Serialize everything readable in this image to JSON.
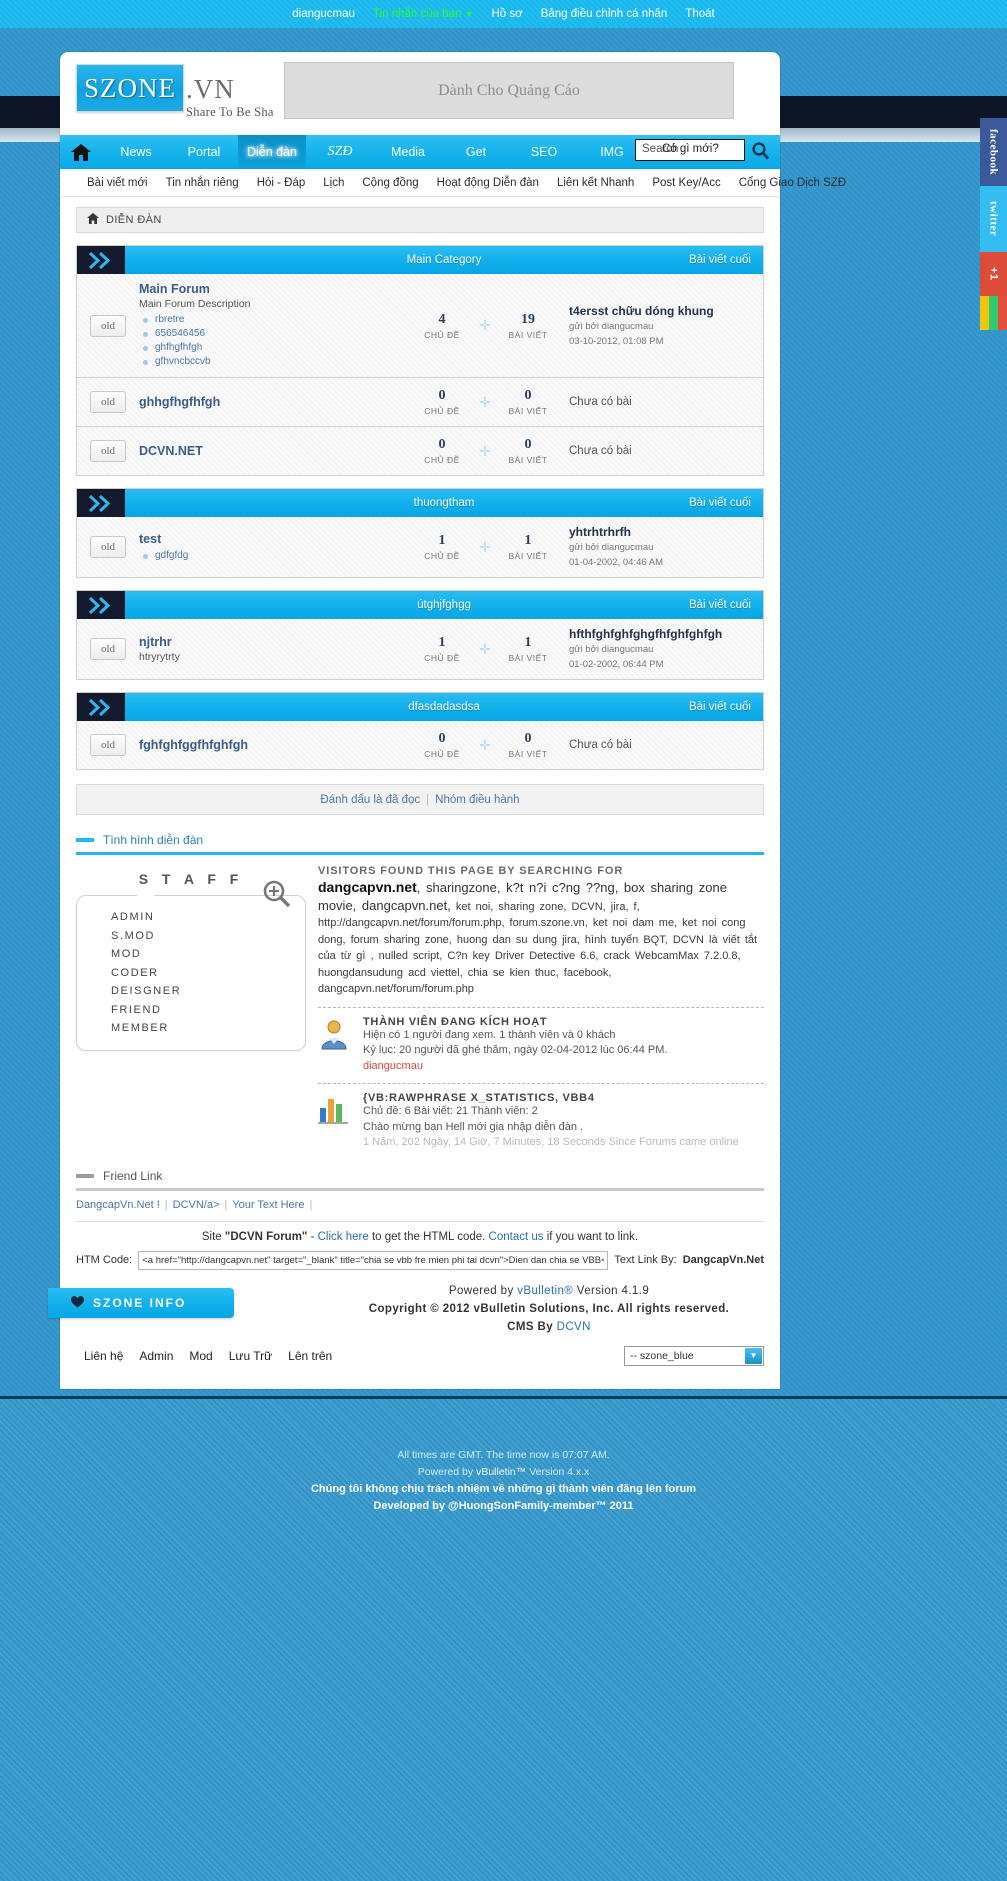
{
  "topbar": {
    "user": "diangucmau",
    "pm": "Tin nhắn của bạn",
    "caret": "▼",
    "profile": "Hồ sơ",
    "cp": "Bảng điều chỉnh cá nhân",
    "logout": "Thoát"
  },
  "header": {
    "logo_text": "SZONE",
    "logo_vn": ".VN",
    "logo_tagline": "Share To Be Sha",
    "ad_text": "Dành Cho Quảng Cáo"
  },
  "nav": {
    "home_icon": "home-icon",
    "items": [
      {
        "label": "News",
        "active": false,
        "italic": false
      },
      {
        "label": "Portal",
        "active": false,
        "italic": false
      },
      {
        "label": "Diễn đàn",
        "active": true,
        "italic": false
      },
      {
        "label": "SZĐ",
        "active": false,
        "italic": true
      },
      {
        "label": "Media",
        "active": false,
        "italic": false
      },
      {
        "label": "Get",
        "active": false,
        "italic": false
      },
      {
        "label": "SEO",
        "active": false,
        "italic": false
      },
      {
        "label": "IMG",
        "active": false,
        "italic": false
      }
    ],
    "search_placeholder": "Search",
    "search_overlay": "Có gì mới?",
    "search_icon": "magnifier-icon"
  },
  "nav2": {
    "items": [
      "Bài viết mới",
      "Tin nhắn riêng",
      "Hỏi - Đáp",
      "Lịch",
      "Cộng đồng",
      "Hoạt động Diễn đàn",
      "Liên kết Nhanh",
      "Post Key/Acc",
      "Cổng Giao Dịch SZĐ"
    ]
  },
  "breadcrumb": {
    "home_icon": "home-icon",
    "label": "DIỄN ĐÀN"
  },
  "forum": {
    "last_post_col": "Bài viết cuối",
    "threads_label": "CHỦ ĐỀ",
    "posts_label": "BÀI VIẾT",
    "no_post": "Chưa có bài",
    "old_badge": "old",
    "categories": [
      {
        "title": "Main Category",
        "rows": [
          {
            "name": "Main Forum",
            "desc": "Main Forum Description",
            "subs": [
              "rbretre",
              "656546456",
              "ghfhgfhfgh",
              "gfhvncbccvb"
            ],
            "threads": "4",
            "posts": "19",
            "last_title": "t4ersst chữu dóng khung",
            "last_by": "gửi bởi diangucmau",
            "last_date": "03-10-2012, 01:08 PM"
          },
          {
            "name": "ghhgfhgfhfgh",
            "desc": "",
            "subs": [],
            "threads": "0",
            "posts": "0",
            "last_title": "Chưa có bài",
            "last_by": "",
            "last_date": ""
          },
          {
            "name": "DCVN.NET",
            "desc": "",
            "subs": [],
            "threads": "0",
            "posts": "0",
            "last_title": "Chưa có bài",
            "last_by": "",
            "last_date": ""
          }
        ]
      },
      {
        "title": "thuongtham",
        "rows": [
          {
            "name": "test",
            "desc": "",
            "subs": [
              "gdfgfdg"
            ],
            "threads": "1",
            "posts": "1",
            "last_title": "yhtrhtrhrfh",
            "last_by": "gửi bởi diangucmau",
            "last_date": "01-04-2002, 04:46 AM"
          }
        ]
      },
      {
        "title": "útghjfghgg",
        "rows": [
          {
            "name": "njtrhr",
            "desc": "htryrytrty",
            "subs": [],
            "threads": "1",
            "posts": "1",
            "last_title": "hfthfghfghfghgfhfghfghfgh",
            "last_by": "gửi bởi diangucmau",
            "last_date": "01-02-2002, 06:44 PM"
          }
        ]
      },
      {
        "title": "dfasdadasdsa",
        "rows": [
          {
            "name": "fghfghfggfhfghfgh",
            "desc": "",
            "subs": [],
            "threads": "0",
            "posts": "0",
            "last_title": "Chưa có bài",
            "last_by": "",
            "last_date": ""
          }
        ]
      }
    ]
  },
  "markbar": {
    "mark_read": "Đánh dấu là đã đọc",
    "separator": "|",
    "mod_team": "Nhóm điều hành"
  },
  "sections": {
    "forum_status": "Tình hình diễn đàn",
    "friend_link": "Friend Link"
  },
  "staff": {
    "title": "S T A F F",
    "magnifier_icon": "magnifier-plus-icon",
    "roles": [
      "ADMIN",
      "S.MOD",
      "MOD",
      "CODER",
      "DEISGNER",
      "FRIEND",
      "MEMBER"
    ]
  },
  "stats": {
    "keywords_head": "VISITORS FOUND THIS PAGE BY SEARCHING FOR",
    "keywords_body_1": "dangcapvn.net",
    "keywords_body_2": ", sharingzone, k?t n?i c?ng ??ng, box sharing zone movie, dangcapvn.net,",
    "keywords_body_3": "ket noi, sharing zone, DCVN, jira, f, http://dangcapvn.net/forum/forum.php, forum.szone.vn, ket noi dam me, ket noi cong dong, forum sharing zone, huong dan su dung jira, hình tuyển BQT, DCVN là viết tắt của từ gì , nulled script, C?n key Driver Detective 6.6, crack WebcamMax 7.2.0.8, huongdansudung acd viettel, chia se kien thuc, facebook, dangcapvn.net/forum/forum.php",
    "active_icon": "user-icon",
    "active_head": "THÀNH VIÊN ĐANG KÍCH HOẠT",
    "active_line1": "Hiện có 1 người đang xem. 1 thành viên và 0 khách",
    "active_line2": "Kỷ lục: 20 người đã ghé thăm, ngày 02-04-2012 lúc 06:44 PM.",
    "active_user": "diangucmau",
    "statistics_icon": "bar-chart-icon",
    "stats_head": "{VB:RAWPHRASE X_STATISTICS, VBB4",
    "stats_line1": "Chủ đề: 6 Bài viết: 21 Thành viên: 2",
    "stats_line2": "Chào mừng bạn Hell mới gia nhập diễn đàn .",
    "stats_line3": "1 Năm, 202 Ngày, 14 Giờ, 7 Minutes, 18 Seconds Since Forums came online"
  },
  "friendlinks": {
    "items": [
      "DangcapVn.Net !",
      "DCVN/a>",
      "Your Text Here"
    ],
    "separator": "|"
  },
  "sitelink": {
    "prefix": "Site",
    "site_name": "\"DCVN Forum\"",
    "dash": "-",
    "click_here": "Click here",
    "mid": "to get the HTML code.",
    "contact": "Contact us",
    "suffix": "if you want to link."
  },
  "htmcode": {
    "label": "HTM Code:",
    "value": "<a href=\"http://dangcapvn.net\" target=\"_blank\" title=\"chia se vbb fre mien phi tai dcvn\">Dien dan chia se VBB</a>",
    "textlink_label": "Text Link By:",
    "textlink_value": "DangcapVn.Net"
  },
  "szone_info": {
    "heart_icon": "heart-icon",
    "label": "SZONE INFO"
  },
  "powered": {
    "line1_pre": "Powered by",
    "line1_link": "vBulletin®",
    "line1_post": "Version 4.1.9",
    "line2": "Copyright © 2012 vBulletin Solutions, Inc. All rights reserved.",
    "line3_pre": "CMS By",
    "line3_link": "DCVN"
  },
  "bottomlinks": {
    "items": [
      "Liên hệ",
      "Admin",
      "Mod",
      "Lưu Trữ",
      "Lên trên"
    ],
    "style_select": "-- szone_blue",
    "style_arrow": "▼"
  },
  "footer": {
    "line1": "All times are GMT. The time now is 07:07 AM.",
    "line2_pre": "Powered by",
    "line2_link": "vBulletin™",
    "line2_post": "Version 4.x.x",
    "line3": "Chúng tôi không chịu trách nhiệm về những gì thành viên đăng lên forum",
    "line4": "Developed by  @HuongSonFamily-member™ 2011"
  },
  "social": {
    "facebook": "facebook",
    "twitter": "twitter",
    "googleplus": "+1"
  },
  "colors": {
    "accent": "#15b7ef",
    "dark": "#141a2e",
    "link": "#4a77a8"
  }
}
